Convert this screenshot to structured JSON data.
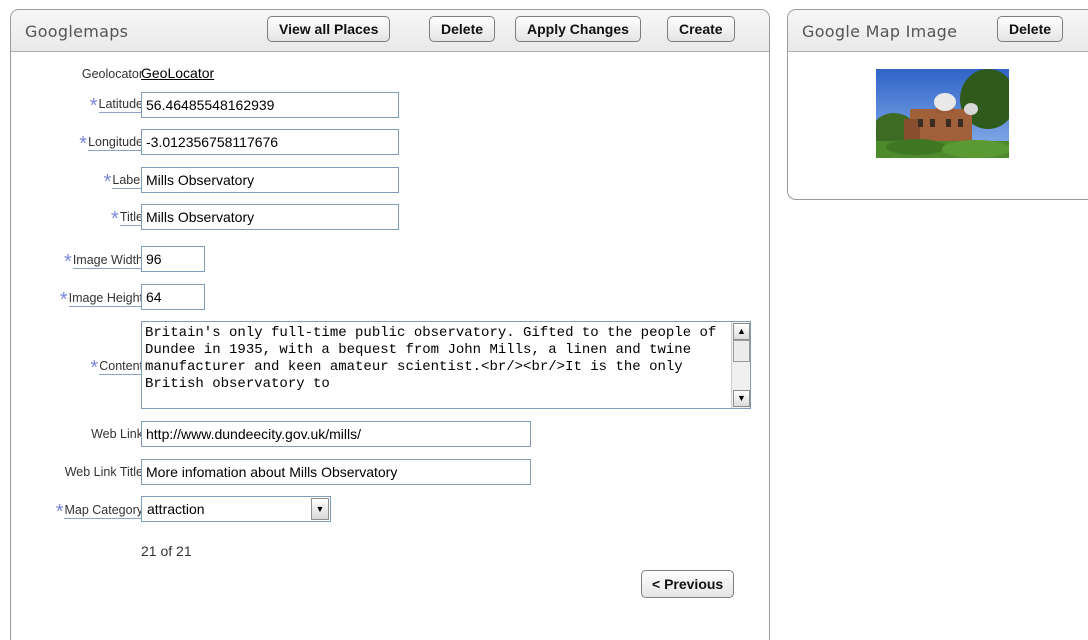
{
  "main": {
    "title": "Googlemaps",
    "buttons": {
      "view_all": "View all Places",
      "delete": "Delete",
      "apply": "Apply Changes",
      "create": "Create"
    },
    "form": {
      "geolocator_label": "Geolocator",
      "geolocator_link": "GeoLocator",
      "latitude_label": "Latitude",
      "latitude_value": "56.46485548162939",
      "longitude_label": "Longitude",
      "longitude_value": "-3.012356758117676",
      "label_label": "Label",
      "label_value": "Mills Observatory",
      "title_label": "Title",
      "title_value": "Mills Observatory",
      "image_width_label": "Image Width",
      "image_width_value": "96",
      "image_height_label": "Image Height",
      "image_height_value": "64",
      "content_label": "Content",
      "content_value": "Britain's only full-time public observatory. Gifted to the people of Dundee in 1935, with a bequest from John Mills, a linen and twine manufacturer and keen amateur scientist.<br/><br/>It is the only British observatory to",
      "web_link_label": "Web Link",
      "web_link_value": "http://www.dundeecity.gov.uk/mills/",
      "web_link_title_label": "Web Link Title",
      "web_link_title_value": "More infomation about Mills Observatory",
      "map_category_label": "Map Category",
      "map_category_value": "attraction",
      "required_marker": "*"
    },
    "pagination": {
      "counter": "21 of 21",
      "previous": "< Previous"
    }
  },
  "side": {
    "title": "Google Map Image",
    "delete": "Delete"
  },
  "colors": {
    "required_star": "#7b86d9",
    "input_border": "#7f9db9",
    "region_header": "#e9e9e9"
  }
}
